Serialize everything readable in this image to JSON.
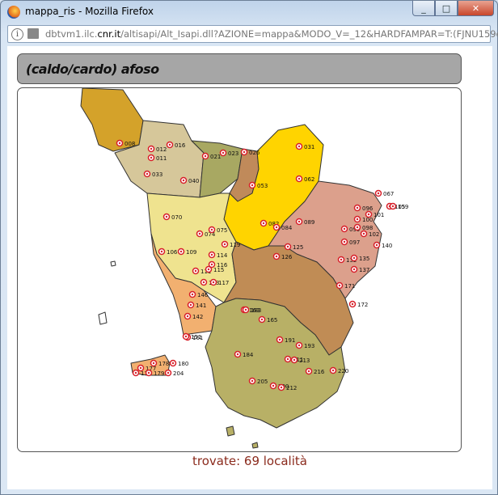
{
  "window": {
    "title": "mappa_ris - Mozilla Firefox",
    "minimize": "_",
    "maximize": "□",
    "close": "✕"
  },
  "urlbar": {
    "prefix": "dbtvm1.ilc.",
    "domain": "cnr.it",
    "path": "/altisapi/Alt_Isapi.dll?AZIONE=mappa&MODO_V=_12&HARDFAMPAR=T:(FJNU159é)"
  },
  "header": {
    "title": "(caldo/cardo) afoso"
  },
  "map": {
    "region_colors": {
      "massa": "#d4a22a",
      "lucca": "#d6c79a",
      "pistoia": "#a8a862",
      "prato": "#c08a5a",
      "firenze": "#ffd400",
      "arezzo": "#dca08c",
      "pisa": "#efe38f",
      "livorno": "#f2b070",
      "siena": "#c08c55",
      "grosseto": "#b8b066"
    },
    "marker_color": "#d8202a",
    "points": [
      {
        "label": "008"
      },
      {
        "label": "012"
      },
      {
        "label": "016"
      },
      {
        "label": "011"
      },
      {
        "label": "021"
      },
      {
        "label": "023"
      },
      {
        "label": "026"
      },
      {
        "label": "031"
      },
      {
        "label": "033"
      },
      {
        "label": "040"
      },
      {
        "label": "053"
      },
      {
        "label": "062"
      },
      {
        "label": "067"
      },
      {
        "label": "070"
      },
      {
        "label": "074"
      },
      {
        "label": "075"
      },
      {
        "label": "082"
      },
      {
        "label": "084"
      },
      {
        "label": "089"
      },
      {
        "label": "096"
      },
      {
        "label": "097"
      },
      {
        "label": "099"
      },
      {
        "label": "100"
      },
      {
        "label": "101"
      },
      {
        "label": "102"
      },
      {
        "label": "105"
      },
      {
        "label": "106"
      },
      {
        "label": "109"
      },
      {
        "label": "111"
      },
      {
        "label": "113"
      },
      {
        "label": "114"
      },
      {
        "label": "115"
      },
      {
        "label": "116"
      },
      {
        "label": "117"
      },
      {
        "label": "119"
      },
      {
        "label": "125"
      },
      {
        "label": "126"
      },
      {
        "label": "132"
      },
      {
        "label": "137"
      },
      {
        "label": "140"
      },
      {
        "label": "141"
      },
      {
        "label": "142"
      },
      {
        "label": "146"
      },
      {
        "label": "161"
      },
      {
        "label": "163"
      },
      {
        "label": "165"
      },
      {
        "label": "171"
      },
      {
        "label": "172"
      },
      {
        "label": "177"
      },
      {
        "label": "178"
      },
      {
        "label": "180"
      },
      {
        "label": "183"
      },
      {
        "label": "184"
      },
      {
        "label": "191"
      },
      {
        "label": "193"
      },
      {
        "label": "200"
      },
      {
        "label": "204"
      },
      {
        "label": "205"
      },
      {
        "label": "211"
      },
      {
        "label": "212"
      },
      {
        "label": "213"
      },
      {
        "label": "216"
      },
      {
        "label": "220"
      },
      {
        "label": "159"
      },
      {
        "label": "135"
      },
      {
        "label": "098"
      },
      {
        "label": "151"
      },
      {
        "label": "176"
      },
      {
        "label": "179"
      }
    ]
  },
  "status": {
    "text": "trovate: 69 località"
  }
}
